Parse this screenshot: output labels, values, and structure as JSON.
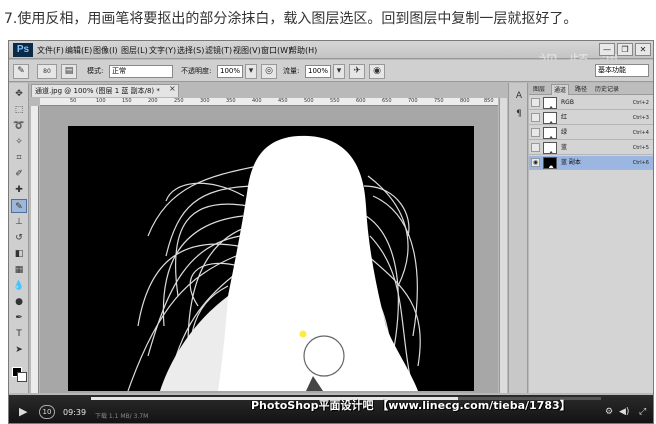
{
  "caption": "7.使用反相，用画笔将要抠出的部分涂抹白，载入图层选区。回到图层中复制一层就抠好了。",
  "app": {
    "logo": "Ps",
    "menu": [
      "文件(F)",
      "编辑(E)",
      "图像(I)",
      "图层(L)",
      "文字(Y)",
      "选择(S)",
      "滤镜(T)",
      "视图(V)",
      "窗口(W)",
      "帮助(H)"
    ],
    "window_buttons": [
      "—",
      "❐",
      "✕"
    ],
    "watermark": "视 频 课",
    "workspace_preset": "基本功能"
  },
  "options_bar": {
    "brush_size": "80",
    "mode_label": "模式:",
    "mode_value": "正常",
    "opacity_label": "不透明度:",
    "opacity_value": "100%",
    "flow_label": "流量:",
    "flow_value": "100%"
  },
  "document": {
    "tab_title": "通道.jpg @ 100% (图层 1 蓝 副本/8) *",
    "close": "×",
    "ruler_ticks": [
      "50",
      "100",
      "150",
      "200",
      "250",
      "300",
      "350",
      "400",
      "450",
      "500",
      "550",
      "600",
      "650",
      "700",
      "750",
      "800",
      "850"
    ]
  },
  "panels": {
    "tabs": [
      "图层",
      "通道",
      "路径",
      "历史记录"
    ],
    "active_tab": 1,
    "channels": [
      {
        "name": "RGB",
        "shortcut": "Ctrl+2",
        "selected": false
      },
      {
        "name": "红",
        "shortcut": "Ctrl+3",
        "selected": false
      },
      {
        "name": "绿",
        "shortcut": "Ctrl+4",
        "selected": false
      },
      {
        "name": "蓝",
        "shortcut": "Ctrl+5",
        "selected": false
      },
      {
        "name": "蓝 副本",
        "shortcut": "Ctrl+6",
        "selected": true
      }
    ]
  },
  "video": {
    "time": "09:39",
    "progress": 0.72,
    "banner": "PhotoShop平面设计吧 【www.linecg.com/tieba/1783】",
    "status": "下载 1.1 MB/ 3.7M",
    "replay_icon": "10"
  },
  "colors": {
    "accent_selected_row": "#9bb6e0",
    "cursor_dot": "#ffeb3b"
  }
}
